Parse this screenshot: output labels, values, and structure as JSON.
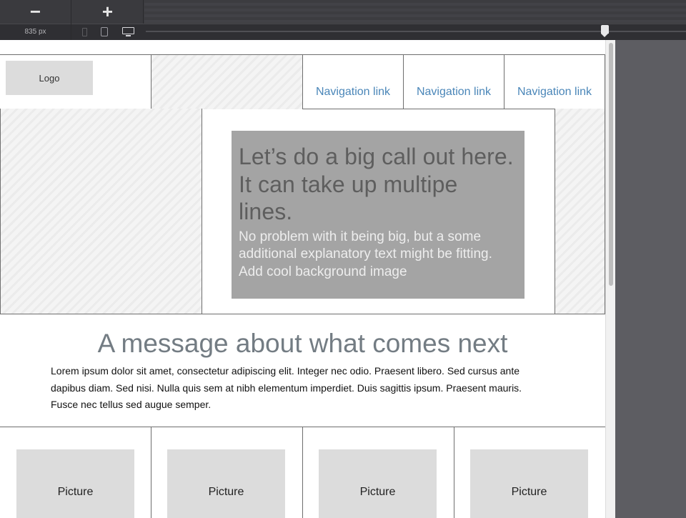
{
  "toolbar": {
    "zoom_out_label": "−",
    "zoom_in_label": "+",
    "width_readout": "835 px",
    "devices": [
      "phone-icon",
      "tablet-icon",
      "desktop-icon"
    ]
  },
  "header": {
    "logo_label": "Logo",
    "nav": [
      {
        "label": "Navigation link"
      },
      {
        "label": "Navigation link"
      },
      {
        "label": "Navigation link"
      }
    ]
  },
  "hero": {
    "title": "Let’s do a big call out here. It can take up multipe lines.",
    "body": "No problem with it being big, but a some additional explanatory text might be fitting. Add cool background image"
  },
  "message": {
    "title": "A message about what comes next",
    "body": "Lorem ipsum dolor sit amet, consectetur adipiscing elit. Integer nec odio. Praesent libero. Sed cursus ante dapibus diam. Sed nisi. Nulla quis sem at nibh elementum imperdiet. Duis sagittis ipsum. Praesent mauris. Fusce nec tellus sed augue semper."
  },
  "pictures": [
    {
      "label": "Picture"
    },
    {
      "label": "Picture"
    },
    {
      "label": "Picture"
    },
    {
      "label": "Picture"
    }
  ],
  "colors": {
    "nav_link": "#4a86b8",
    "callout_bg": "#a4a4a4",
    "message_title": "#737c83",
    "app_chrome": "#3a3a3e"
  }
}
